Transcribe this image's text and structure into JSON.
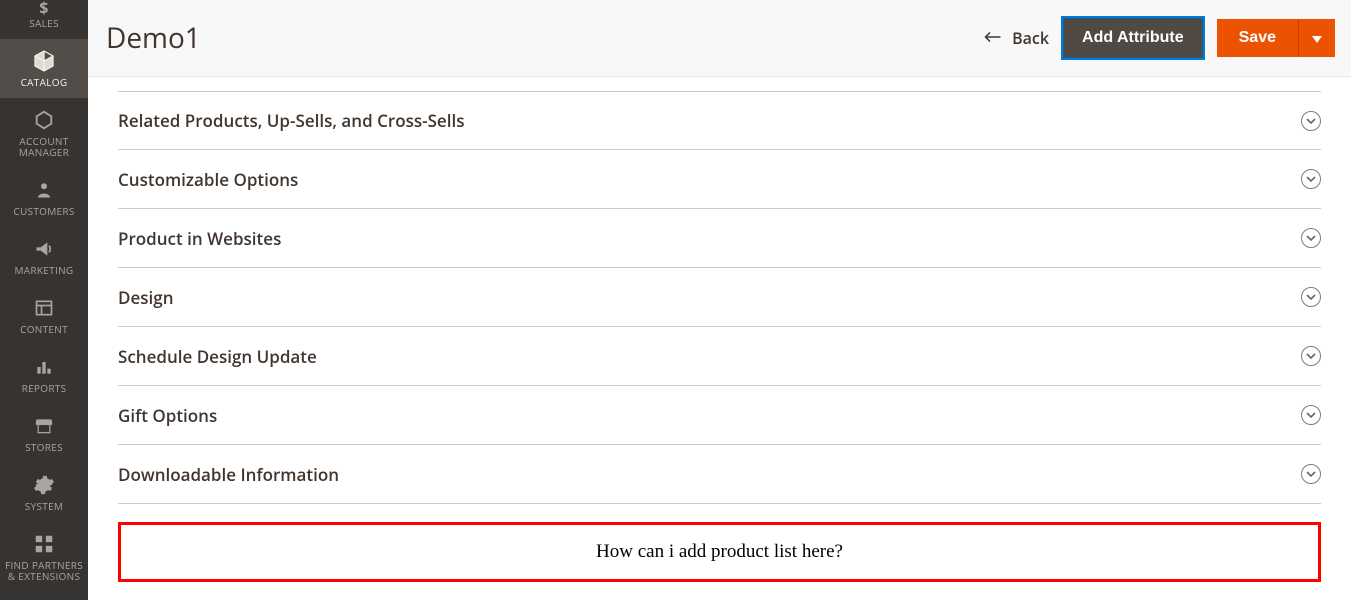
{
  "sidebar": {
    "items": [
      {
        "label": "SALES",
        "icon": "dollar"
      },
      {
        "label": "CATALOG",
        "icon": "cube",
        "active": true
      },
      {
        "label": "ACCOUNT MANAGER",
        "icon": "hexagon"
      },
      {
        "label": "CUSTOMERS",
        "icon": "person"
      },
      {
        "label": "MARKETING",
        "icon": "megaphone"
      },
      {
        "label": "CONTENT",
        "icon": "layout"
      },
      {
        "label": "REPORTS",
        "icon": "bars"
      },
      {
        "label": "STORES",
        "icon": "storefront"
      },
      {
        "label": "SYSTEM",
        "icon": "gear"
      },
      {
        "label": "FIND PARTNERS & EXTENSIONS",
        "icon": "blocks"
      }
    ]
  },
  "header": {
    "page_title": "Demo1",
    "back_label": "Back",
    "add_attribute_label": "Add Attribute",
    "save_label": "Save"
  },
  "sections": [
    {
      "title": "Related Products, Up-Sells, and Cross-Sells"
    },
    {
      "title": "Customizable Options"
    },
    {
      "title": "Product in Websites"
    },
    {
      "title": "Design"
    },
    {
      "title": "Schedule Design Update"
    },
    {
      "title": "Gift Options"
    },
    {
      "title": "Downloadable Information"
    }
  ],
  "annotation": {
    "text": "How  can i add product list here?"
  }
}
